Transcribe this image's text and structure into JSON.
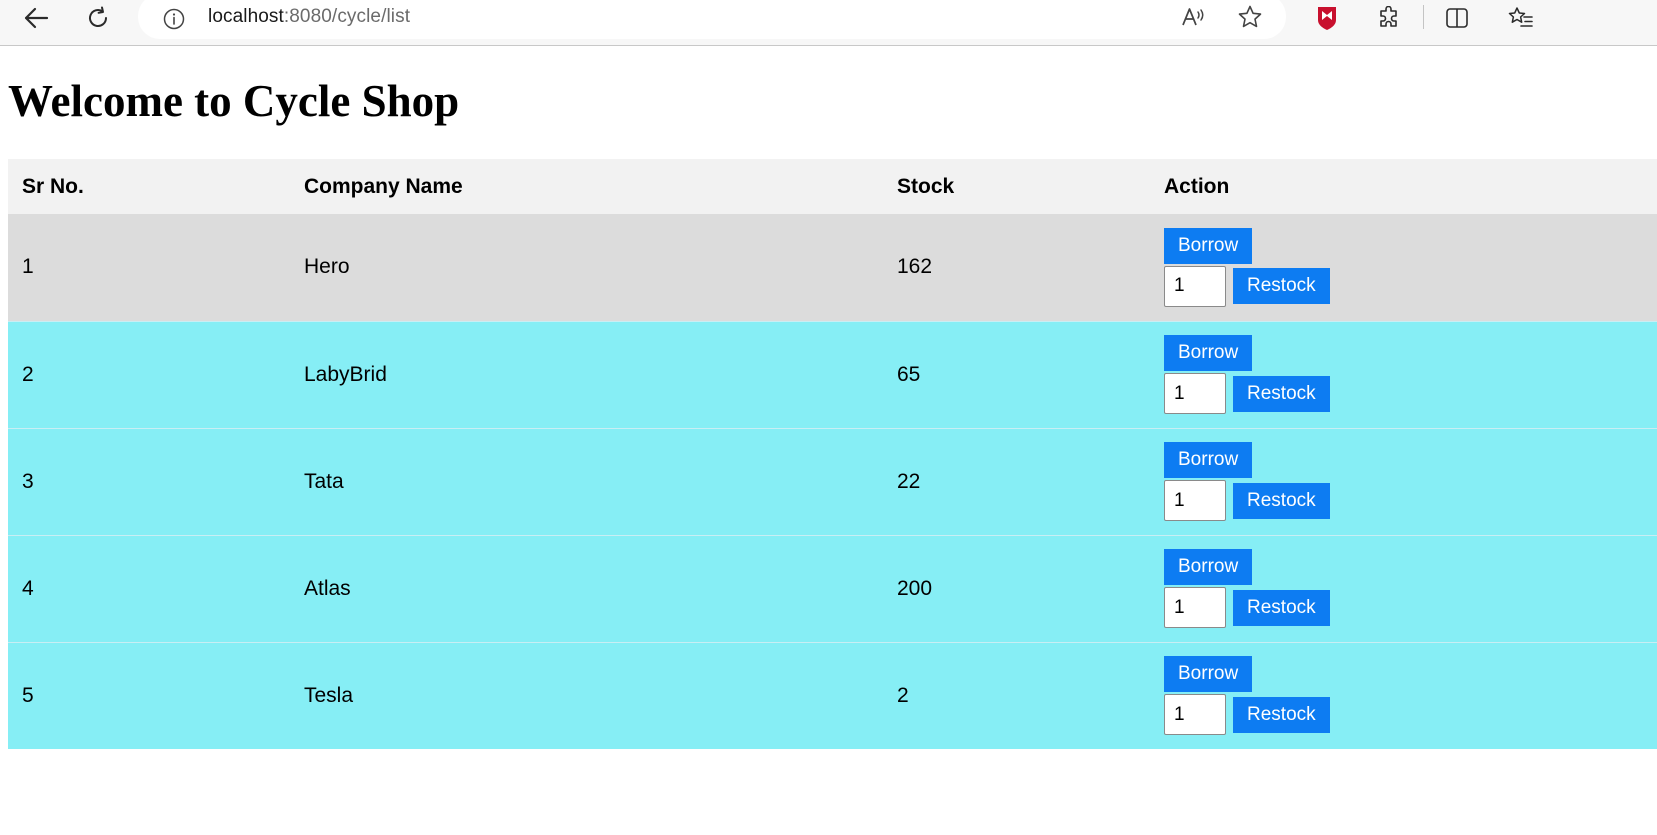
{
  "browser": {
    "url_host": "localhost",
    "url_path": ":8080/cycle/list",
    "icons": {
      "back": "back-arrow-icon",
      "refresh": "refresh-icon",
      "info": "info-icon",
      "read_aloud": "read-aloud-icon",
      "favorite": "star-icon",
      "mcafee": "mcafee-shield-icon",
      "extensions": "puzzle-icon",
      "split_screen": "split-screen-icon",
      "favorites": "favorites-list-icon"
    },
    "accent_colors": {
      "mcafee": "#c8102e"
    }
  },
  "page": {
    "title": "Welcome to Cycle Shop"
  },
  "table": {
    "headers": {
      "sr_no": "Sr No.",
      "company": "Company Name",
      "stock": "Stock",
      "action": "Action"
    },
    "rows": [
      {
        "sr_no": "1",
        "company": "Hero",
        "stock": "162",
        "borrow_label": "Borrow",
        "restock_label": "Restock",
        "qty": "1"
      },
      {
        "sr_no": "2",
        "company": "LabyBrid",
        "stock": "65",
        "borrow_label": "Borrow",
        "restock_label": "Restock",
        "qty": "1"
      },
      {
        "sr_no": "3",
        "company": "Tata",
        "stock": "22",
        "borrow_label": "Borrow",
        "restock_label": "Restock",
        "qty": "1"
      },
      {
        "sr_no": "4",
        "company": "Atlas",
        "stock": "200",
        "borrow_label": "Borrow",
        "restock_label": "Restock",
        "qty": "1"
      },
      {
        "sr_no": "5",
        "company": "Tesla",
        "stock": "2",
        "borrow_label": "Borrow",
        "restock_label": "Restock",
        "qty": "1"
      }
    ]
  },
  "colors": {
    "header_bg": "#f2f2f2",
    "first_row_bg": "#dcdcdc",
    "row_bg": "#86eef5",
    "button_bg": "#0d7cf2",
    "button_text": "#ffffff"
  }
}
